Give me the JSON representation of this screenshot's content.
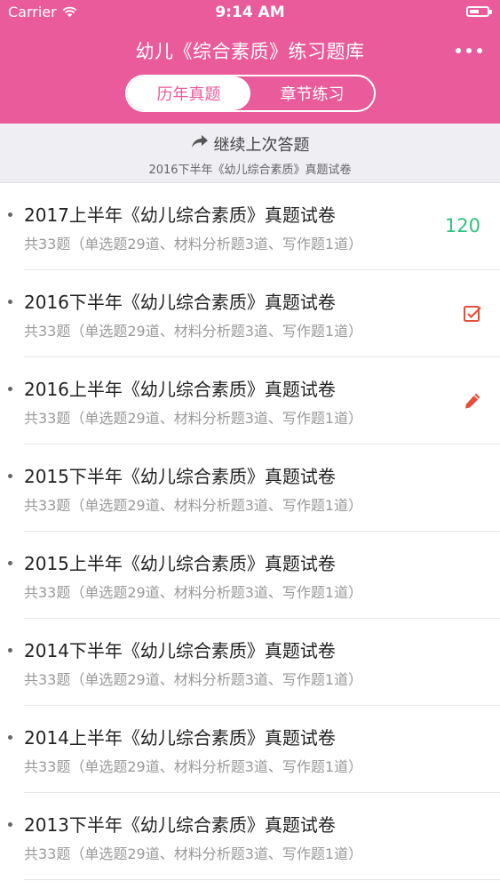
{
  "status_bar": {
    "carrier": "Carrier",
    "time": "9:14 AM"
  },
  "nav": {
    "title": "幼儿《综合素质》练习题库"
  },
  "tabs": [
    {
      "label": "历年真题",
      "active": true
    },
    {
      "label": "章节练习",
      "active": false
    }
  ],
  "resume": {
    "label": "继续上次答题",
    "paper": "2016下半年《幼儿综合素质》真题试卷"
  },
  "papers": [
    {
      "title": "2017上半年《幼儿综合素质》真题试卷",
      "summary": "共33题（单选题29道、材料分析题3道、写作题1道）",
      "count": "120"
    },
    {
      "title": "2016下半年《幼儿综合素质》真题试卷",
      "summary": "共33题（单选题29道、材料分析题3道、写作题1道）",
      "icon": "checkbox-checked-icon"
    },
    {
      "title": "2016上半年《幼儿综合素质》真题试卷",
      "summary": "共33题（单选题29道、材料分析题3道、写作题1道）",
      "icon": "pencil-icon"
    },
    {
      "title": "2015下半年《幼儿综合素质》真题试卷",
      "summary": "共33题（单选题29道、材料分析题3道、写作题1道）"
    },
    {
      "title": "2015上半年《幼儿综合素质》真题试卷",
      "summary": "共33题（单选题29道、材料分析题3道、写作题1道）"
    },
    {
      "title": "2014下半年《幼儿综合素质》真题试卷",
      "summary": "共33题（单选题29道、材料分析题3道、写作题1道）"
    },
    {
      "title": "2014上半年《幼儿综合素质》真题试卷",
      "summary": "共33题（单选题29道、材料分析题3道、写作题1道）"
    },
    {
      "title": "2013下半年《幼儿综合素质》真题试卷",
      "summary": "共33题（单选题29道、材料分析题3道、写作题1道）"
    }
  ],
  "colors": {
    "brand": "#e95b9b",
    "count_green": "#2ec27e",
    "icon_red": "#e4503c"
  }
}
